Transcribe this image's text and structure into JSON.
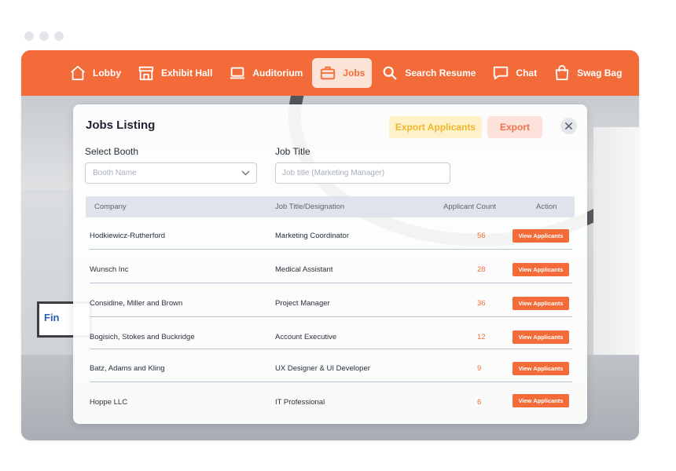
{
  "nav": {
    "items": [
      {
        "label": "Lobby",
        "icon": "home-icon"
      },
      {
        "label": "Exhibit Hall",
        "icon": "store-icon"
      },
      {
        "label": "Auditorium",
        "icon": "laptop-icon"
      },
      {
        "label": "Jobs",
        "icon": "briefcase-icon",
        "active": true
      },
      {
        "label": "Search Resume",
        "icon": "search-icon"
      },
      {
        "label": "Chat",
        "icon": "chat-icon"
      },
      {
        "label": "Swag Bag",
        "icon": "bag-icon"
      }
    ],
    "accent": "#f26b38"
  },
  "background": {
    "screen_logo": "Fin"
  },
  "modal": {
    "title": "Jobs Listing",
    "export_applicants_label": "Export Applicants",
    "export_label": "Export",
    "select_booth_label": "Select Booth",
    "booth_placeholder": "Booth Name",
    "job_title_label": "Job Title",
    "job_title_placeholder": "Job title (Marketing Manager)",
    "columns": [
      "Company",
      "Job Title/Designation",
      "Applicant Count",
      "Action"
    ],
    "rows": [
      {
        "company": "Hodkiewicz-Rutherford",
        "title": "Marketing Coordinator",
        "count": "56",
        "action": "View Applicants"
      },
      {
        "company": "Wunsch Inc",
        "title": "Medical Assistant",
        "count": "28",
        "action": "View Applicants"
      },
      {
        "company": "Considine, Miller and Brown",
        "title": "Project Manager",
        "count": "36",
        "action": "View Applicants"
      },
      {
        "company": "Bogisich, Stokes and Buckridge",
        "title": "Account Executive",
        "count": "12",
        "action": "View Applicants"
      },
      {
        "company": "Batz, Adams and Kling",
        "title": "UX Designer & UI Developer",
        "count": "9",
        "action": "View Applicants"
      },
      {
        "company": "Hoppe LLC",
        "title": "IT Professional",
        "count": "6",
        "action": "View Applicants"
      }
    ]
  },
  "colors": {
    "accent": "#f26b38",
    "export_applicants_bg": "#fff1c8",
    "export_applicants_text": "#f0b52c",
    "export_bg": "#fde2dc",
    "table_header_bg": "#dfe4ec"
  }
}
